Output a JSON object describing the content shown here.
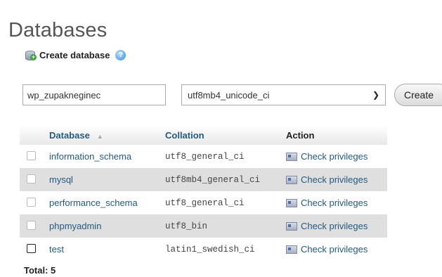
{
  "page": {
    "title": "Databases"
  },
  "create": {
    "label": "Create database",
    "db_name_value": "wp_zupakneginec",
    "collation_value": "utf8mb4_unicode_ci",
    "button_label": "Create"
  },
  "table": {
    "headers": {
      "database": "Database",
      "collation": "Collation",
      "action": "Action"
    },
    "rows": [
      {
        "name": "information_schema",
        "collation": "utf8_general_ci",
        "action": "Check privileges"
      },
      {
        "name": "mysql",
        "collation": "utf8mb4_general_ci",
        "action": "Check privileges"
      },
      {
        "name": "performance_schema",
        "collation": "utf8_general_ci",
        "action": "Check privileges"
      },
      {
        "name": "phpmyadmin",
        "collation": "utf8_bin",
        "action": "Check privileges"
      },
      {
        "name": "test",
        "collation": "latin1_swedish_ci",
        "action": "Check privileges"
      }
    ],
    "total": "Total: 5"
  },
  "icons": {
    "create_db": "database-add-icon",
    "help": "help-icon",
    "privileges": "privileges-icon",
    "sort": "sort-ascending-icon"
  }
}
